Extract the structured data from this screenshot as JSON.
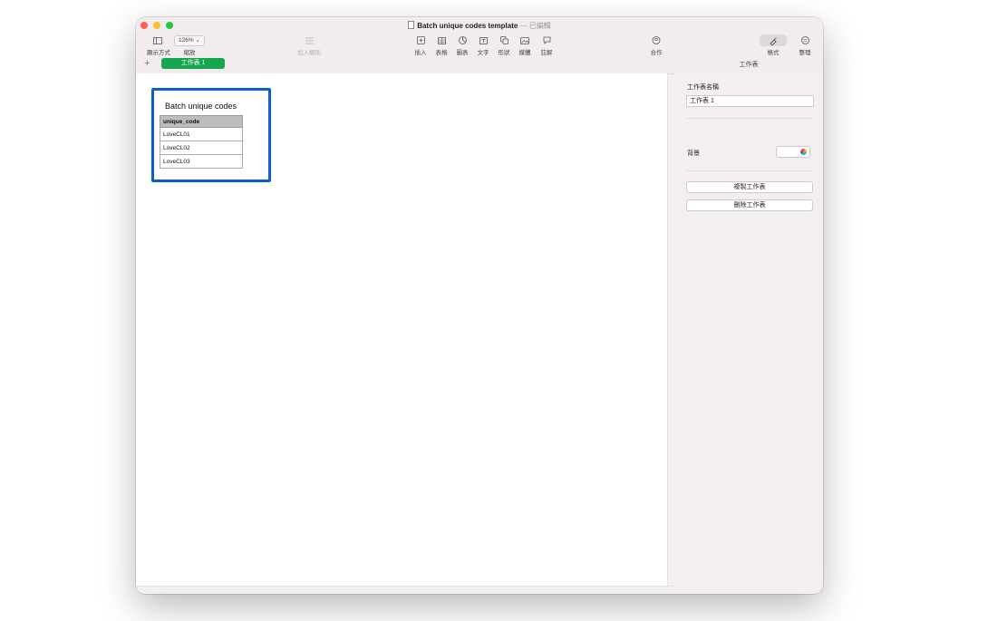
{
  "window": {
    "title": "Batch unique codes template",
    "title_separator": "—",
    "subtitle": "已編輯"
  },
  "toolbar": {
    "view_label": "顯示方式",
    "zoom_value": "126%",
    "zoom_label": "縮放",
    "add_category_label": "加入類別",
    "insert_label": "插入",
    "table_label": "表格",
    "chart_label": "圖表",
    "text_label": "文字",
    "shape_label": "形狀",
    "media_label": "媒體",
    "comment_label": "註解",
    "collaborate_label": "合作",
    "format_label": "格式",
    "organize_label": "整理"
  },
  "tabs": {
    "add_symbol": "+",
    "sheets": [
      {
        "label": "工作表 1",
        "active": true,
        "color": "#14a74d"
      }
    ]
  },
  "sheet": {
    "table_title": "Batch unique codes",
    "header": "unique_code",
    "rows": [
      "LoveCL01",
      "LoveCL02",
      "LoveCL03"
    ]
  },
  "panel": {
    "heading": "工作表",
    "name_label": "工作表名稱",
    "name_value": "工作表 1",
    "background_label": "背景",
    "duplicate_button": "複製工作表",
    "delete_button": "刪除工作表"
  },
  "icons": [
    "sidebar-icon",
    "chevron-down-icon",
    "list-icon",
    "insert-icon",
    "table-icon",
    "chart-icon",
    "text-icon",
    "shape-icon",
    "media-icon",
    "comment-icon",
    "collaborate-icon",
    "format-brush-icon",
    "organize-icon",
    "color-wheel-icon",
    "document-icon"
  ],
  "colors": {
    "selection": "#0b5fd0",
    "sheet_tab": "#14a74d"
  }
}
